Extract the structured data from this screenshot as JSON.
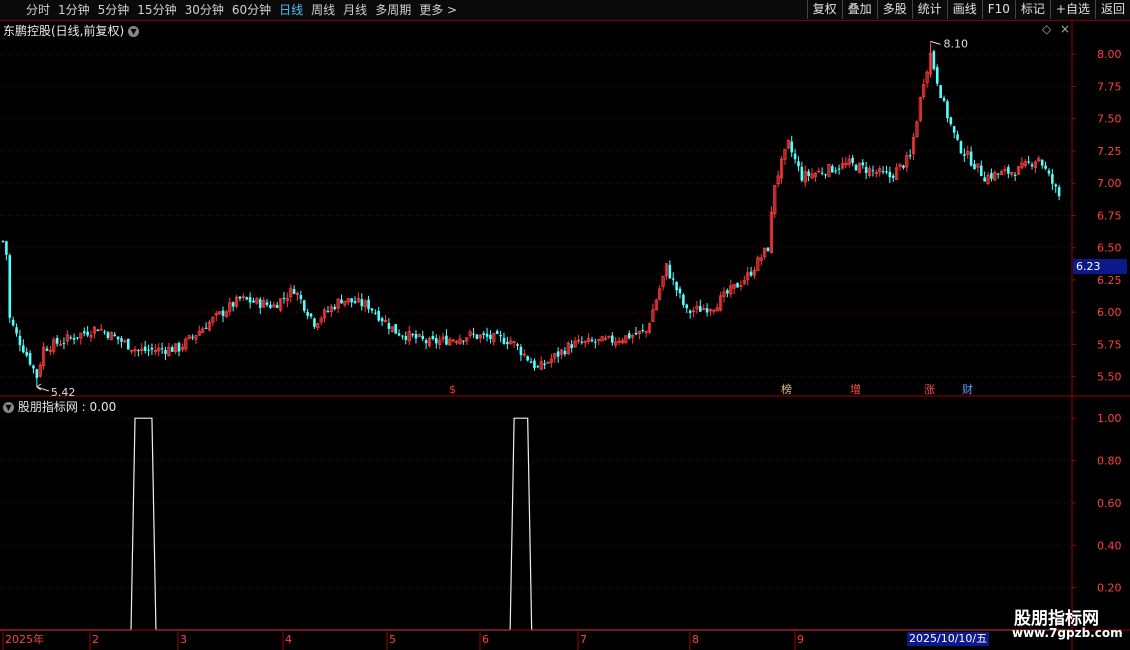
{
  "toolbar": {
    "periods": [
      "分时",
      "1分钟",
      "5分钟",
      "15分钟",
      "30分钟",
      "60分钟",
      "日线",
      "周线",
      "月线",
      "多周期",
      "更多 >"
    ],
    "active_period": "日线",
    "tools": [
      "复权",
      "叠加",
      "多股",
      "统计",
      "画线",
      "F10",
      "标记",
      "+自选",
      "返回"
    ]
  },
  "main_panel": {
    "title": "东鹏控股(日线,前复权)",
    "y_ticks": [
      "8.00",
      "7.75",
      "7.50",
      "7.25",
      "7.00",
      "6.75",
      "6.50",
      "6.25",
      "6.00",
      "5.75",
      "5.50"
    ],
    "current_price": "6.23",
    "high_label": "8.10",
    "low_label": "5.42",
    "markers": [
      {
        "text": "$",
        "color": "#ff3030"
      },
      {
        "text": "榜",
        "color": "#e0c080"
      },
      {
        "text": "增",
        "color": "#ff5050"
      },
      {
        "text": "涨",
        "color": "#ff5050"
      },
      {
        "text": "财",
        "color": "#5aa0ff"
      }
    ]
  },
  "indicator_panel": {
    "title": "股朋指标网 : 0.00",
    "y_ticks": [
      "1.00",
      "0.80",
      "0.60",
      "0.40",
      "0.20"
    ]
  },
  "x_axis": {
    "labels": [
      "2025年",
      "2",
      "3",
      "4",
      "5",
      "6",
      "7",
      "8",
      "9"
    ],
    "current_date": "2025/10/10/五"
  },
  "watermark": {
    "title": "股朋指标网",
    "url": "www.7gpzb.com"
  },
  "colors": {
    "up": "#ff3c3c",
    "down": "#54ffff",
    "grid": "#6a0000",
    "axis": "#a00000",
    "active": "#49c2ff"
  },
  "chart_data": {
    "type": "candlestick",
    "symbol": "东鹏控股",
    "y_range": [
      5.35,
      8.25
    ],
    "x_labels": [
      "2025年",
      "2",
      "3",
      "4",
      "5",
      "6",
      "7",
      "8",
      "9"
    ],
    "close_path": [
      {
        "i": 0,
        "v": 6.55
      },
      {
        "i": 1,
        "v": 6.45
      },
      {
        "i": 2,
        "v": 5.95
      },
      {
        "i": 4,
        "v": 5.82
      },
      {
        "i": 8,
        "v": 5.62
      },
      {
        "i": 10,
        "v": 5.5
      },
      {
        "i": 12,
        "v": 5.72
      },
      {
        "i": 18,
        "v": 5.78
      },
      {
        "i": 28,
        "v": 5.88
      },
      {
        "i": 40,
        "v": 5.7
      },
      {
        "i": 52,
        "v": 5.72
      },
      {
        "i": 60,
        "v": 5.9
      },
      {
        "i": 70,
        "v": 6.1
      },
      {
        "i": 80,
        "v": 6.05
      },
      {
        "i": 86,
        "v": 6.18
      },
      {
        "i": 92,
        "v": 5.92
      },
      {
        "i": 100,
        "v": 6.1
      },
      {
        "i": 108,
        "v": 6.05
      },
      {
        "i": 116,
        "v": 5.85
      },
      {
        "i": 126,
        "v": 5.76
      },
      {
        "i": 138,
        "v": 5.82
      },
      {
        "i": 150,
        "v": 5.78
      },
      {
        "i": 158,
        "v": 5.56
      },
      {
        "i": 168,
        "v": 5.75
      },
      {
        "i": 180,
        "v": 5.78
      },
      {
        "i": 190,
        "v": 5.85
      },
      {
        "i": 196,
        "v": 6.35
      },
      {
        "i": 202,
        "v": 6.0
      },
      {
        "i": 210,
        "v": 6.05
      },
      {
        "i": 220,
        "v": 6.28
      },
      {
        "i": 226,
        "v": 6.5
      },
      {
        "i": 228,
        "v": 7.0
      },
      {
        "i": 232,
        "v": 7.3
      },
      {
        "i": 236,
        "v": 7.05
      },
      {
        "i": 250,
        "v": 7.15
      },
      {
        "i": 262,
        "v": 7.05
      },
      {
        "i": 268,
        "v": 7.2
      },
      {
        "i": 272,
        "v": 7.8
      },
      {
        "i": 274,
        "v": 8.0
      },
      {
        "i": 278,
        "v": 7.6
      },
      {
        "i": 282,
        "v": 7.3
      },
      {
        "i": 290,
        "v": 7.05
      },
      {
        "i": 300,
        "v": 7.1
      },
      {
        "i": 306,
        "v": 7.2
      },
      {
        "i": 312,
        "v": 6.9
      }
    ],
    "high": {
      "i": 274,
      "v": 8.1
    },
    "low": {
      "i": 10,
      "v": 5.42
    },
    "indicator": {
      "name": "股朋指标网",
      "value": 0.0,
      "y_range": [
        0,
        1.1
      ],
      "signal_ranges": [
        [
          39,
          44
        ],
        [
          151,
          155
        ]
      ]
    }
  }
}
